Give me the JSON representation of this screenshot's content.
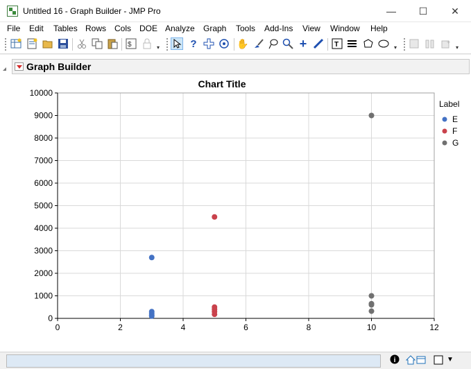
{
  "window": {
    "title": "Untitled 16 - Graph Builder - JMP Pro",
    "minimize_glyph": "—",
    "maximize_glyph": "☐",
    "close_glyph": "✕"
  },
  "menu": [
    "File",
    "Edit",
    "Tables",
    "Rows",
    "Cols",
    "DOE",
    "Analyze",
    "Graph",
    "Tools",
    "Add-Ins",
    "View",
    "Window",
    "Help"
  ],
  "toolbar": {
    "icons": [
      "new-data-table-icon",
      "new-script-icon",
      "open-icon",
      "save-icon",
      "cut-icon",
      "copy-icon",
      "paste-icon",
      "script-icon",
      "lock-icon",
      "arrow-icon",
      "help-icon",
      "crosshair-icon",
      "selection-icon",
      "grabber-icon",
      "brush-icon",
      "lasso-icon",
      "magnifier-icon",
      "plus-icon",
      "line-icon",
      "text-icon",
      "lines-icon",
      "polygon-icon",
      "ellipse-icon",
      "layout-icon",
      "columns-icon",
      "add-icon"
    ]
  },
  "graph_builder": {
    "title": "Graph Builder"
  },
  "chart_data": {
    "type": "scatter",
    "title": "Chart Title",
    "xlim": [
      0,
      12
    ],
    "ylim": [
      0,
      10000
    ],
    "x_ticks": [
      "0",
      "2",
      "4",
      "6",
      "8",
      "10",
      "12"
    ],
    "y_ticks": [
      "0",
      "1000",
      "2000",
      "3000",
      "4000",
      "5000",
      "6000",
      "7000",
      "8000",
      "9000",
      "10000"
    ],
    "grid": true,
    "legend": {
      "title": "Label",
      "placement": "right"
    },
    "series": [
      {
        "name": "E",
        "color": "#4472c4",
        "points": [
          [
            3,
            2700
          ],
          [
            3,
            300
          ],
          [
            3,
            230
          ],
          [
            3,
            150
          ],
          [
            3,
            100
          ]
        ]
      },
      {
        "name": "F",
        "color": "#c9424c",
        "points": [
          [
            5,
            4500
          ],
          [
            5,
            500
          ],
          [
            5,
            400
          ],
          [
            5,
            300
          ],
          [
            5,
            180
          ]
        ]
      },
      {
        "name": "G",
        "color": "#707070",
        "points": [
          [
            10,
            9000
          ],
          [
            10,
            1000
          ],
          [
            10,
            650
          ],
          [
            10,
            600
          ],
          [
            10,
            320
          ]
        ]
      }
    ]
  },
  "status": {
    "info_glyph": "i"
  }
}
